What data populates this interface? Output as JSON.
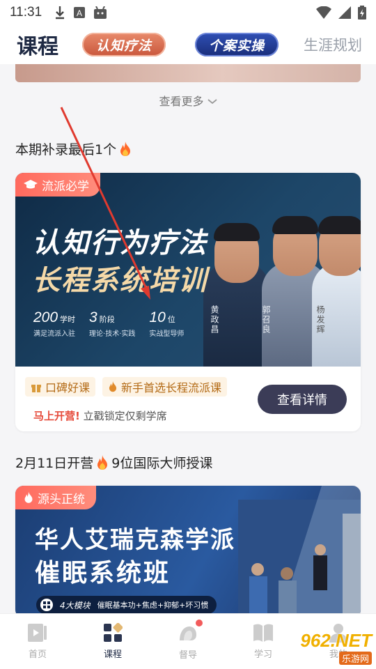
{
  "status_bar": {
    "time": "11:31"
  },
  "top_tabs": {
    "current": "课程",
    "pill1": "认知疗法",
    "pill2": "个案实操",
    "plain": "生涯规划"
  },
  "see_more": "查看更多",
  "section1": {
    "title": "本期补录最后1个"
  },
  "course1": {
    "badge": "流派必学",
    "line1": "认知行为疗法",
    "line2": "长程系统培训",
    "stats": [
      {
        "num": "200",
        "unit": "学时",
        "desc": "满足流派入驻"
      },
      {
        "num": "3",
        "unit": "阶段",
        "desc": "理论·技术·实践"
      },
      {
        "num": "10",
        "unit": "位",
        "desc": "实战型导师"
      }
    ],
    "teachers": [
      "黄政昌",
      "郭召良",
      "杨发辉"
    ],
    "chip1": "口碑好课",
    "chip2": "新手首选长程流派课",
    "urgent_red": "马上开营!",
    "urgent_rest": "立戳锁定仅剩学席",
    "button": "查看详情"
  },
  "section2": {
    "title_a": "2月11日开营",
    "title_b": "9位国际大师授课"
  },
  "course2": {
    "badge": "源头正统",
    "line1": "华人艾瑞克森学派",
    "line2": "催眠系统班",
    "module_title": "4大模块",
    "module_desc": "催眠基本功+焦虑+抑郁+坏习惯"
  },
  "bottom_nav": [
    {
      "label": "首页",
      "icon": "play-icon"
    },
    {
      "label": "课程",
      "icon": "grid-icon"
    },
    {
      "label": "督导",
      "icon": "heads-icon"
    },
    {
      "label": "学习",
      "icon": "book-icon"
    },
    {
      "label": "我的",
      "icon": "user-icon"
    }
  ],
  "watermark": {
    "top": "962.NET",
    "bottom": "乐游网"
  },
  "colors": {
    "accent": "#1f2a44",
    "urgent": "#e64b3b",
    "badge": "#ff6a5e",
    "chip_text": "#b36a15"
  }
}
